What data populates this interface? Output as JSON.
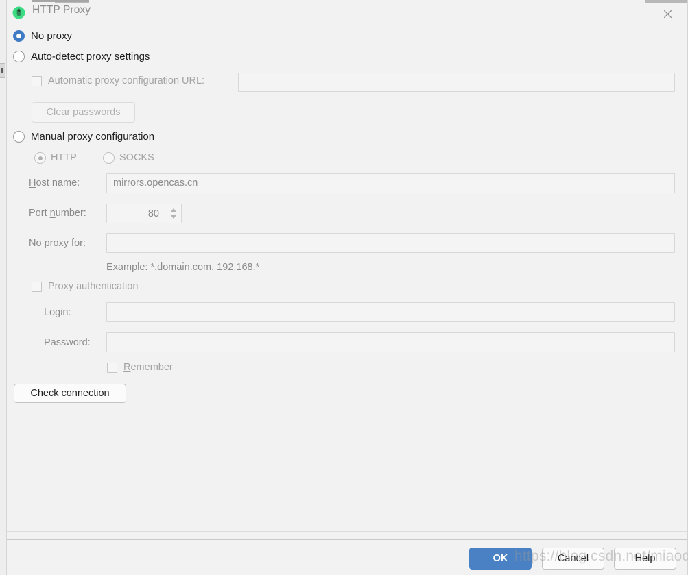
{
  "window": {
    "title": "HTTP Proxy",
    "app_icon": "android-studio-icon",
    "close_label": "✕"
  },
  "proxy_mode": {
    "options": [
      {
        "id": "no-proxy",
        "label": "No proxy",
        "selected": true
      },
      {
        "id": "auto-detect",
        "label": "Auto-detect proxy settings",
        "selected": false
      },
      {
        "id": "manual",
        "label": "Manual proxy configuration",
        "selected": false
      }
    ]
  },
  "auto_detect": {
    "pac_checkbox_label_pre": "",
    "pac_checkbox_label": "Automatic proxy configuration URL:",
    "pac_url_value": "",
    "pac_url_placeholder": "",
    "clear_passwords_label": "Clear passwords"
  },
  "manual": {
    "protocol": {
      "http_label": "HTTP",
      "socks_label": "SOCKS",
      "selected": "HTTP"
    },
    "host_name": {
      "label_mnemonic": "H",
      "label_rest": "ost name:",
      "value": "mirrors.opencas.cn"
    },
    "port_number": {
      "label_pre": "Port ",
      "label_mnemonic": "n",
      "label_rest": "umber:",
      "value": "80"
    },
    "no_proxy_for": {
      "label": "No proxy for:",
      "value": "",
      "expand_icon": "expand-icon",
      "hint": "Example: *.domain.com, 192.168.*"
    },
    "authentication": {
      "checkbox_label_pre": "Proxy ",
      "checkbox_label_mnemonic": "a",
      "checkbox_label_rest": "uthentication",
      "login": {
        "label_mnemonic": "L",
        "label_rest": "ogin:",
        "value": ""
      },
      "password": {
        "label_mnemonic": "P",
        "label_rest": "assword:",
        "value": ""
      },
      "remember": {
        "label_mnemonic": "R",
        "label_rest": "emember",
        "checked": false
      }
    },
    "check_connection_label": "Check connection"
  },
  "footer": {
    "ok_label": "OK",
    "cancel_label": "Cancel",
    "help_label": "Help"
  },
  "watermark": {
    "text": "https://blog.csdn.net/miaodichiyou"
  },
  "colors": {
    "accent": "#4a81c4",
    "radio_selected": "#3e7bc4",
    "dialog_bg": "#f2f2f2",
    "field_bg": "#f4f4f4",
    "field_border": "#d8d8d8",
    "disabled_text": "#a3a3a3",
    "label_text": "#8a8a8a",
    "icon_green": "#3ddc84"
  }
}
